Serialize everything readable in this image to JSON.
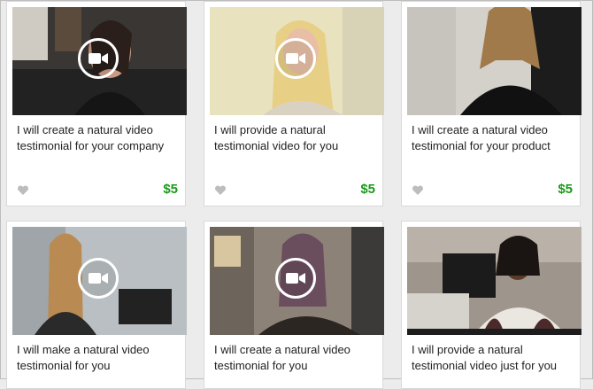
{
  "gigs": [
    {
      "title": "I will create a natural video testimonial for your company",
      "price": "$5",
      "has_video": true
    },
    {
      "title": "I will provide a natural testimonial video for you",
      "price": "$5",
      "has_video": true
    },
    {
      "title": "I will create a natural video testimonial for your product",
      "price": "$5",
      "has_video": false
    },
    {
      "title": "I will make a natural video testimonial for you",
      "price": "",
      "has_video": true
    },
    {
      "title": "I will create a natural video testimonial for you",
      "price": "",
      "has_video": true
    },
    {
      "title": "I will provide a natural testimonial video just for you",
      "price": "",
      "has_video": false
    }
  ],
  "icons": {
    "video": "video-camera-icon",
    "favorite": "heart-icon"
  },
  "colors": {
    "price": "#1a9a1a",
    "heart": "#bdbdbd",
    "card_border": "#d9d9d9"
  }
}
